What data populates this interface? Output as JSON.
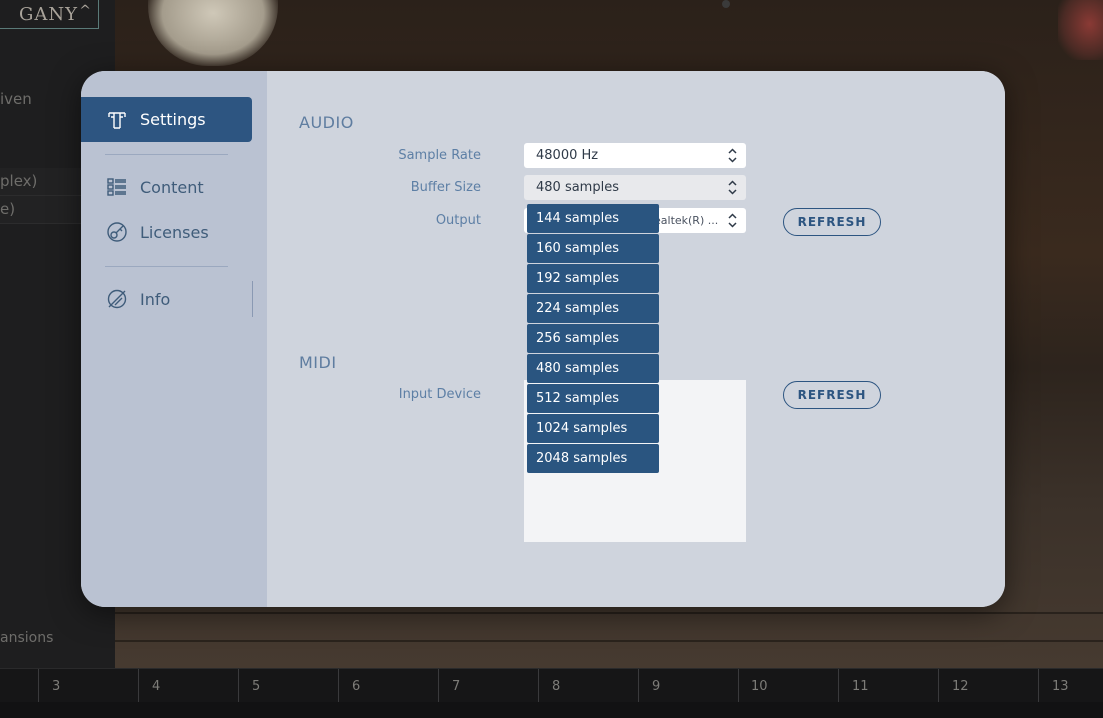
{
  "background": {
    "preset_name": "GANY",
    "side_texts": [
      "iven",
      "plex)",
      "e)",
      "ansions"
    ],
    "timeline_marks": [
      "3",
      "4",
      "5",
      "6",
      "7",
      "8",
      "9",
      "10",
      "11",
      "12",
      "13"
    ]
  },
  "colors": {
    "accent": "#2d5581",
    "label": "#5d7fa5",
    "sidebar_bg": "#bac2d2",
    "content_bg": "#cfd4dd"
  },
  "sidebar": {
    "items": [
      {
        "label": "Settings",
        "icon": "settings-icon"
      },
      {
        "label": "Content",
        "icon": "content-icon"
      },
      {
        "label": "Licenses",
        "icon": "licenses-icon"
      },
      {
        "label": "Info",
        "icon": "info-icon"
      }
    ]
  },
  "audio": {
    "title": "AUDIO",
    "sample_rate_label": "Sample Rate",
    "sample_rate_value": "48000 Hz",
    "buffer_size_label": "Buffer Size",
    "buffer_size_value": "480 samples",
    "output_label": "Output",
    "output_value_visible": "ealtek(R) ...",
    "refresh_label": "REFRESH"
  },
  "midi": {
    "title": "MIDI",
    "input_device_label": "Input Device",
    "refresh_label": "REFRESH"
  },
  "buffer_dropdown": {
    "options": [
      "144 samples",
      "160 samples",
      "192 samples",
      "224 samples",
      "256 samples",
      "480 samples",
      "512 samples",
      "1024 samples",
      "2048 samples"
    ]
  }
}
